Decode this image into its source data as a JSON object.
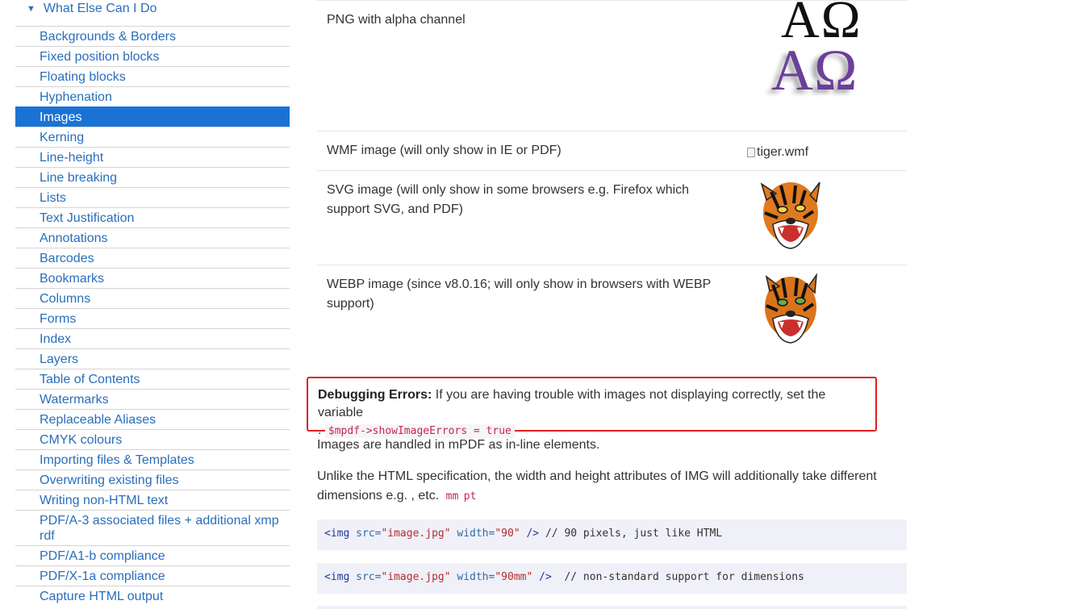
{
  "sidebar": {
    "section_title": "What Else Can I Do",
    "items": [
      {
        "label": "Backgrounds & Borders",
        "active": false
      },
      {
        "label": "Fixed position blocks",
        "active": false
      },
      {
        "label": "Floating blocks",
        "active": false
      },
      {
        "label": "Hyphenation",
        "active": false
      },
      {
        "label": "Images",
        "active": true
      },
      {
        "label": "Kerning",
        "active": false
      },
      {
        "label": "Line-height",
        "active": false
      },
      {
        "label": "Line breaking",
        "active": false
      },
      {
        "label": "Lists",
        "active": false
      },
      {
        "label": "Text Justification",
        "active": false
      },
      {
        "label": "Annotations",
        "active": false
      },
      {
        "label": "Barcodes",
        "active": false
      },
      {
        "label": "Bookmarks",
        "active": false
      },
      {
        "label": "Columns",
        "active": false
      },
      {
        "label": "Forms",
        "active": false
      },
      {
        "label": "Index",
        "active": false
      },
      {
        "label": "Layers",
        "active": false
      },
      {
        "label": "Table of Contents",
        "active": false
      },
      {
        "label": "Watermarks",
        "active": false
      },
      {
        "label": "Replaceable Aliases",
        "active": false
      },
      {
        "label": "CMYK colours",
        "active": false
      },
      {
        "label": "Importing files & Templates",
        "active": false
      },
      {
        "label": "Overwriting existing files",
        "active": false
      },
      {
        "label": "Writing non-HTML text",
        "active": false
      },
      {
        "label": "PDF/A-3 associated files + additional xmp rdf",
        "active": false
      },
      {
        "label": "PDF/A1-b compliance",
        "active": false
      },
      {
        "label": "PDF/X-1a compliance",
        "active": false
      },
      {
        "label": "Capture HTML output",
        "active": false
      }
    ]
  },
  "image_table": [
    {
      "desc": "PNG with alpha channel",
      "kind": "alpha",
      "glyph_top": "AΩ",
      "glyph_bottom": "AΩ"
    },
    {
      "desc": "WMF image (will only show in IE or PDF)",
      "kind": "broken",
      "alt": "tiger.wmf"
    },
    {
      "desc": "SVG image (will only show in some browsers e.g. Firefox which support SVG, and PDF)",
      "kind": "tiger"
    },
    {
      "desc": "WEBP image (since v8.0.16; will only show in browsers with WEBP support)",
      "kind": "tiger"
    }
  ],
  "debug_note": {
    "label": "Debugging Errors:",
    "text": " If you are having trouble with images not displaying correctly, set the variable",
    "prefix": ". ",
    "code": "$mpdf->showImageErrors = true"
  },
  "para1": "Images are handled in mPDF as in-line elements.",
  "para2": {
    "text": "Unlike the HTML specification, the width and height attributes of IMG will additionally take different dimensions e.g. , etc.",
    "code1": "mm",
    "code2": "pt"
  },
  "code_examples": [
    {
      "tag": "<img",
      "attr1": " src=",
      "val1": "\"image.jpg\"",
      "attr2": " width=",
      "val2": "\"90\"",
      "close": " />",
      "comment": " // 90 pixels, just like HTML"
    },
    {
      "tag": "<img",
      "attr1": " src=",
      "val1": "\"image.jpg\"",
      "attr2": " width=",
      "val2": "\"90mm\"",
      "close": " />",
      "comment": "  // non-standard support for dimensions"
    }
  ]
}
